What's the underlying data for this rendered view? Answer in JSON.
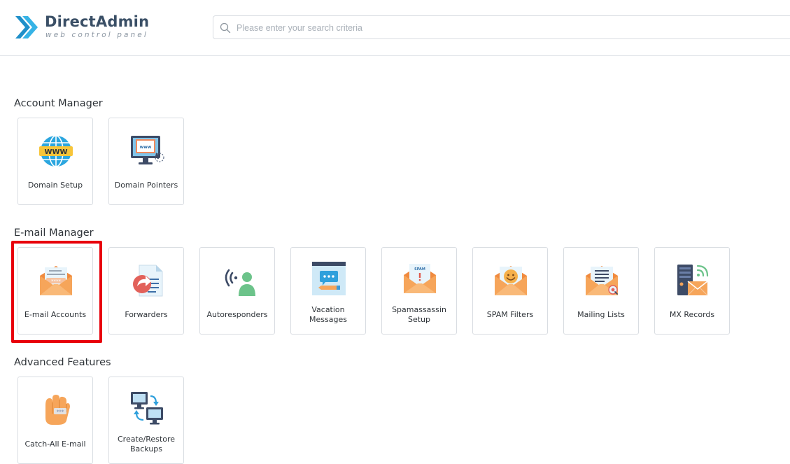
{
  "header": {
    "logo_title": "DirectAdmin",
    "logo_subtitle": "web control panel",
    "search_placeholder": "Please enter your search criteria"
  },
  "sections": [
    {
      "title": "Account Manager",
      "items": [
        {
          "label": "Domain Setup",
          "icon": "globe-www-icon"
        },
        {
          "label": "Domain Pointers",
          "icon": "monitor-pointer-icon"
        }
      ]
    },
    {
      "title": "E-mail Manager",
      "items": [
        {
          "label": "E-mail Accounts",
          "icon": "envelope-password-icon",
          "highlighted": true
        },
        {
          "label": "Forwarders",
          "icon": "document-forward-icon"
        },
        {
          "label": "Autoresponders",
          "icon": "person-broadcast-icon"
        },
        {
          "label": "Vacation Messages",
          "icon": "message-pencil-icon"
        },
        {
          "label": "Spamassassin Setup",
          "icon": "envelope-spam-icon"
        },
        {
          "label": "SPAM Filters",
          "icon": "envelope-smiley-icon"
        },
        {
          "label": "Mailing Lists",
          "icon": "envelope-list-icon"
        },
        {
          "label": "MX Records",
          "icon": "server-mail-icon"
        }
      ]
    },
    {
      "title": "Advanced Features",
      "items": [
        {
          "label": "Catch-All E-mail",
          "icon": "glove-hand-icon"
        },
        {
          "label": "Create/Restore Backups",
          "icon": "computers-sync-icon"
        }
      ]
    }
  ],
  "colors": {
    "highlight": "#e8000b",
    "envelope": "#f6a55a",
    "logo_blue": "#2ea8e0",
    "text_dark": "#2e3338"
  }
}
